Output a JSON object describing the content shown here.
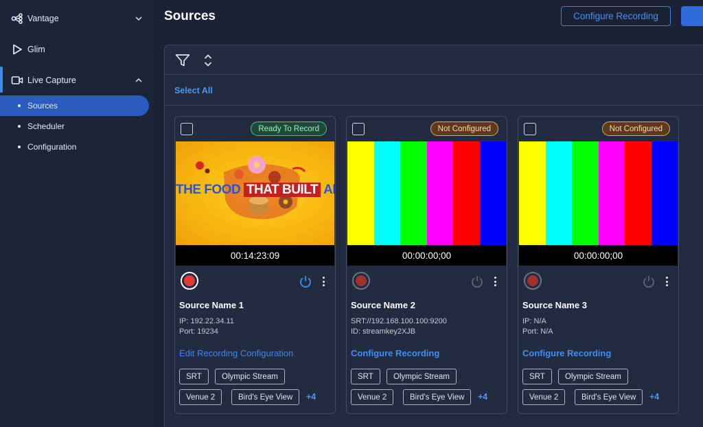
{
  "sidebar": {
    "vantage": "Vantage",
    "glim": "Glim",
    "live_capture": "Live Capture",
    "sub_items": [
      "Sources",
      "Scheduler",
      "Configuration"
    ]
  },
  "header": {
    "title": "Sources",
    "configure_button": "Configure Recording"
  },
  "toolbar": {
    "select_all": "Select All",
    "icons": [
      "filter-icon",
      "sort-icon"
    ]
  },
  "cards": [
    {
      "status": "Ready To Record",
      "thumb_title_left": "THE FOOD",
      "thumb_title_mid": "THAT BUILT",
      "thumb_title_right": "AMERICA",
      "timecode": "00:14:23:09",
      "name": "Source Name 1",
      "meta1": "IP: 192.22.34.11",
      "meta2": "Port: 19234",
      "link": "Edit Recording Configuration",
      "tags": [
        "SRT",
        "Olympic Stream",
        "Venue 2",
        "Bird's Eye View"
      ],
      "more": "+4"
    },
    {
      "status": "Not Configured",
      "timecode": "00:00:00;00",
      "name": "Source Name 2",
      "meta1": "SRT://192.168.100.100:9200",
      "meta2": "ID: streamkey2XJB",
      "link": "Configure Recording",
      "tags": [
        "SRT",
        "Olympic Stream",
        "Venue 2",
        "Bird's Eye View"
      ],
      "more": "+4"
    },
    {
      "status": "Not Configured",
      "timecode": "00:00:00;00",
      "name": "Source Name 3",
      "meta1": "IP: N/A",
      "meta2": "Port: N/A",
      "link": "Configure Recording",
      "tags": [
        "SRT",
        "Olympic Stream",
        "Venue 2",
        "Bird's Eye View"
      ],
      "more": "+4"
    }
  ],
  "colors": {
    "accent": "#3a8bf0",
    "ready": "#3ecb88",
    "not_configured": "#f0a64a",
    "record": "#e53b33",
    "color_bars": [
      "#ffff00",
      "#00ffff",
      "#00ff00",
      "#ff00ff",
      "#ff0000",
      "#0000ff"
    ]
  }
}
